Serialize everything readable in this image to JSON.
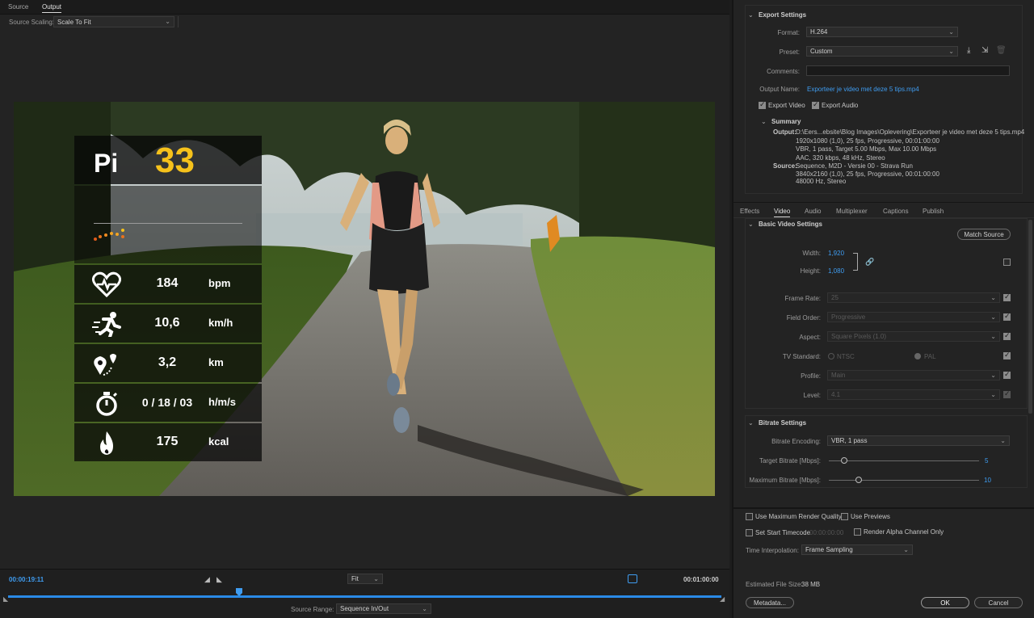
{
  "source_tabs": {
    "source": "Source",
    "output": "Output"
  },
  "source_scaling": {
    "label": "Source Scaling:",
    "value": "Scale To Fit"
  },
  "overlay": {
    "title_label": "Pi",
    "title_value": "33",
    "title_value_color": "#f6c21b",
    "rows": [
      {
        "icon": "heart-rate-icon",
        "value": "184",
        "unit": "bpm"
      },
      {
        "icon": "runner-icon",
        "value": "10,6",
        "unit": "km/h"
      },
      {
        "icon": "route-pin-icon",
        "value": "3,2",
        "unit": "km"
      },
      {
        "icon": "stopwatch-icon",
        "value": "0 / 18 / 03",
        "unit": "h/m/s"
      },
      {
        "icon": "flame-icon",
        "value": "175",
        "unit": "kcal"
      }
    ]
  },
  "timeline": {
    "current_time": "00:00:19:11",
    "end_time": "00:01:00:00",
    "zoom": "Fit",
    "source_range_label": "Source Range:",
    "source_range_value": "Sequence In/Out"
  },
  "export_settings": {
    "header": "Export Settings",
    "format_label": "Format:",
    "format_value": "H.264",
    "preset_label": "Preset:",
    "preset_value": "Custom",
    "comments_label": "Comments:",
    "output_name_label": "Output Name:",
    "output_name_value": "Exporteer je video met deze 5 tips.mp4",
    "export_video_label": "Export Video",
    "export_audio_label": "Export Audio",
    "summary_header": "Summary",
    "summary_output_label": "Output:",
    "summary_output_lines": [
      "D:\\Eers...ebsite\\Blog Images\\Oplevering\\Exporteer je video met deze 5 tips.mp4",
      "1920x1080 (1,0), 25 fps, Progressive, 00:01:00:00",
      "VBR, 1 pass, Target 5.00 Mbps, Max 10.00 Mbps",
      "AAC, 320 kbps, 48 kHz, Stereo"
    ],
    "summary_source_label": "Source:",
    "summary_source_lines": [
      "Sequence, M2D - Versie 00 - Strava Run",
      "3840x2160 (1,0), 25 fps, Progressive, 00:01:00:00",
      "48000 Hz, Stereo"
    ]
  },
  "settings_tabs": [
    "Effects",
    "Video",
    "Audio",
    "Multiplexer",
    "Captions",
    "Publish"
  ],
  "video": {
    "basic_header": "Basic Video Settings",
    "match_source": "Match Source",
    "width_label": "Width:",
    "width_value": "1,920",
    "height_label": "Height:",
    "height_value": "1,080",
    "frame_rate_label": "Frame Rate:",
    "frame_rate_value": "25",
    "field_order_label": "Field Order:",
    "field_order_value": "Progressive",
    "aspect_label": "Aspect:",
    "aspect_value": "Square Pixels (1.0)",
    "tv_standard_label": "TV Standard:",
    "ntsc": "NTSC",
    "pal": "PAL",
    "profile_label": "Profile:",
    "profile_value": "Main",
    "level_label": "Level:",
    "level_value": "4.1",
    "bitrate_header": "Bitrate Settings",
    "bitrate_encoding_label": "Bitrate Encoding:",
    "bitrate_encoding_value": "VBR, 1 pass",
    "target_bitrate_label": "Target Bitrate [Mbps]:",
    "target_bitrate_value": "5",
    "max_bitrate_label": "Maximum Bitrate [Mbps]:",
    "max_bitrate_value": "10"
  },
  "bottom": {
    "max_render_quality": "Use Maximum Render Quality",
    "use_previews": "Use Previews",
    "set_start_timecode": "Set Start Timecode",
    "start_timecode_value": "00:00:00:00",
    "render_alpha": "Render Alpha Channel Only",
    "time_interp_label": "Time Interpolation:",
    "time_interp_value": "Frame Sampling",
    "estimated_size_label": "Estimated File Size:",
    "estimated_size_value": "38 MB",
    "metadata_button": "Metadata...",
    "ok_button": "OK",
    "cancel_button": "Cancel"
  },
  "colors": {
    "accent": "#3f9cf0",
    "panel": "#232323",
    "overlay_yellow": "#f6c21b"
  }
}
